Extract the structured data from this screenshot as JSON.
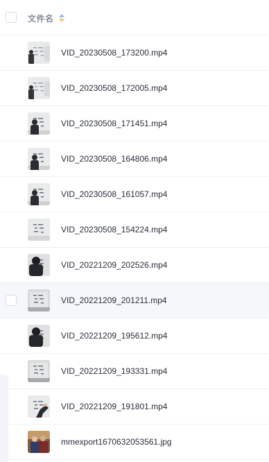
{
  "header": {
    "column_label": "文件名",
    "sort_icon": "sort-icon"
  },
  "files": [
    {
      "name": "VID_20230508_173200.mp4",
      "thumb_style": "board-person-left"
    },
    {
      "name": "VID_20230508_172005.mp4",
      "thumb_style": "board-person-left"
    },
    {
      "name": "VID_20230508_171451.mp4",
      "thumb_style": "person-board"
    },
    {
      "name": "VID_20230508_164806.mp4",
      "thumb_style": "person-board"
    },
    {
      "name": "VID_20230508_161057.mp4",
      "thumb_style": "person-board"
    },
    {
      "name": "VID_20230508_154224.mp4",
      "thumb_style": "board-notes"
    },
    {
      "name": "VID_20221209_202526.mp4",
      "thumb_style": "person-close"
    },
    {
      "name": "VID_20221209_201211.mp4",
      "thumb_style": "board-notes-dark",
      "hovered": true
    },
    {
      "name": "VID_20221209_195612.mp4",
      "thumb_style": "person-close"
    },
    {
      "name": "VID_20221209_193331.mp4",
      "thumb_style": "board-notes-dark"
    },
    {
      "name": "VID_20221209_191801.mp4",
      "thumb_style": "hand-board"
    },
    {
      "name": "mmexport1670632053561.jpg",
      "thumb_style": "photo-people"
    }
  ],
  "colors": {
    "row_border": "#eef0f4",
    "hover_bg": "#f6f7fa",
    "header_text": "#848b99",
    "sort_up": "#8fb8ff",
    "sort_down": "#f5c36a"
  }
}
